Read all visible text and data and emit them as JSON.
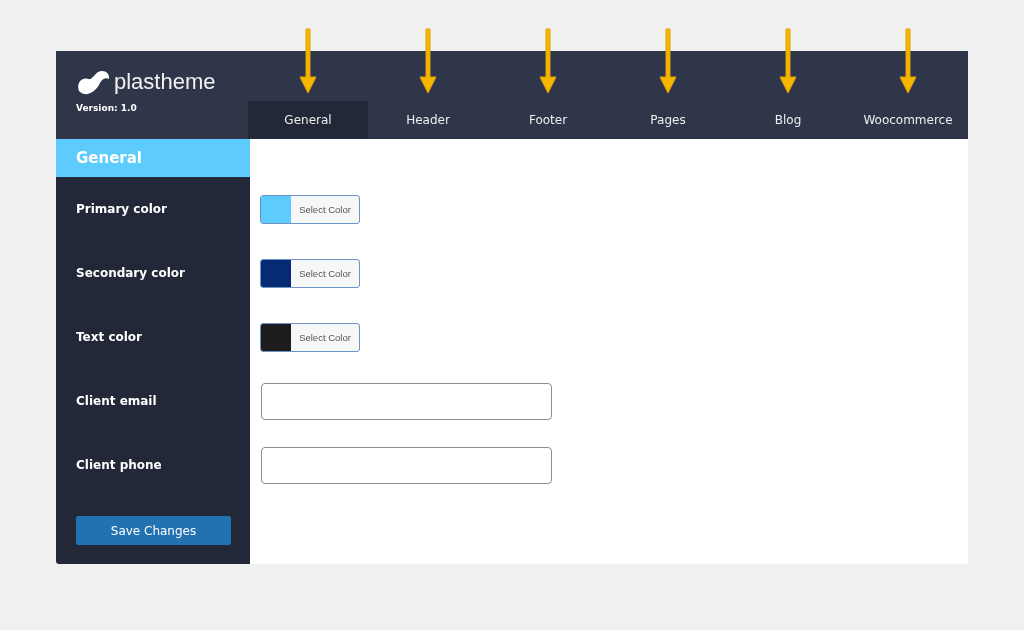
{
  "brand": {
    "name": "plastheme",
    "version": "Version: 1.0"
  },
  "tabs": [
    {
      "label": "General",
      "selected": true
    },
    {
      "label": "Header",
      "selected": false
    },
    {
      "label": "Footer",
      "selected": false
    },
    {
      "label": "Pages",
      "selected": false
    },
    {
      "label": "Blog",
      "selected": false
    },
    {
      "label": "Woocommerce",
      "selected": false
    }
  ],
  "section": {
    "title": "General"
  },
  "fields": [
    {
      "label": "Primary color",
      "kind": "color",
      "color": "#5ecbfd",
      "button": "Select Color"
    },
    {
      "label": "Secondary color",
      "kind": "color",
      "color": "#062a74",
      "button": "Select Color"
    },
    {
      "label": "Text color",
      "kind": "color",
      "color": "#1c1c1c",
      "button": "Select Color"
    },
    {
      "label": "Client email",
      "kind": "text"
    },
    {
      "label": "Client phone",
      "kind": "text"
    }
  ],
  "save_button": "Save Changes"
}
